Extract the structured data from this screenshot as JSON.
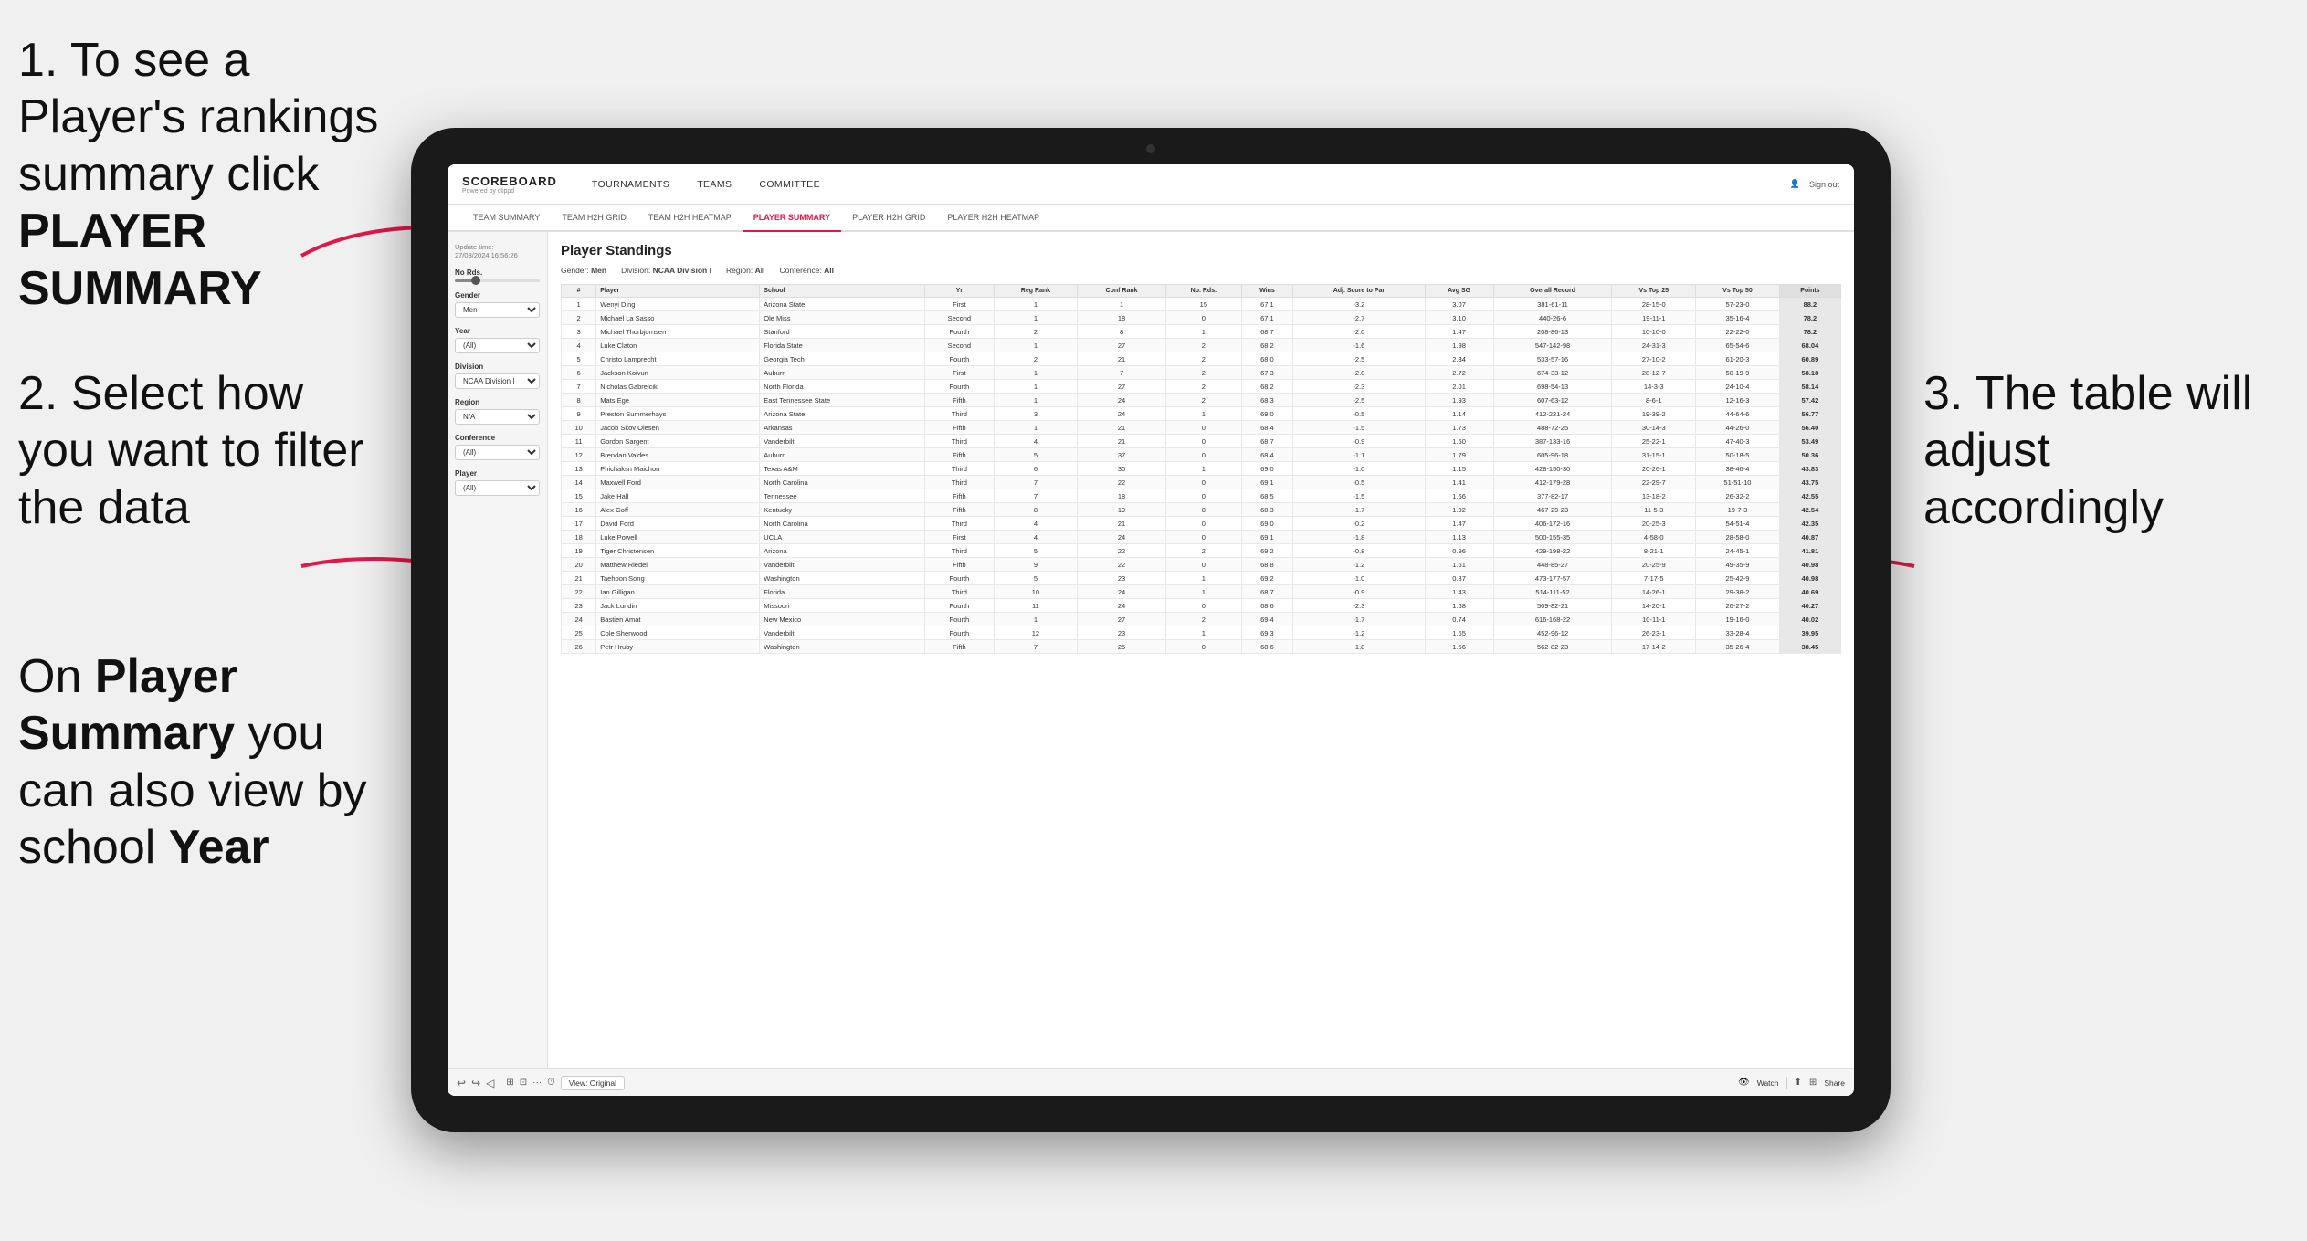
{
  "instructions": {
    "step1": "1. To see a Player's rankings summary click ",
    "step1_bold": "PLAYER SUMMARY",
    "step2": "2. Select how you want to filter the data",
    "step3": "3. The table will adjust accordingly",
    "step4_prefix": "On ",
    "step4_bold1": "Player Summary",
    "step4_middle": " you can also view by school ",
    "step4_bold2": "Year"
  },
  "header": {
    "logo": "SCOREBOARD",
    "logo_sub": "Powered by clippd",
    "nav": [
      "TOURNAMENTS",
      "TEAMS",
      "COMMITTEE"
    ],
    "sign_out": "Sign out"
  },
  "sub_nav": {
    "items": [
      "TEAM SUMMARY",
      "TEAM H2H GRID",
      "TEAM H2H HEATMAP",
      "PLAYER SUMMARY",
      "PLAYER H2H GRID",
      "PLAYER H2H HEATMAP"
    ],
    "active": "PLAYER SUMMARY"
  },
  "sidebar": {
    "update_label": "Update time:",
    "update_time": "27/03/2024 16:56:26",
    "no_rds_label": "No Rds.",
    "gender_label": "Gender",
    "gender_value": "Men",
    "year_label": "Year",
    "year_value": "(All)",
    "division_label": "Division",
    "division_value": "NCAA Division I",
    "region_label": "Region",
    "region_value": "N/A",
    "conference_label": "Conference",
    "conference_value": "(All)",
    "player_label": "Player",
    "player_value": "(All)"
  },
  "table": {
    "title": "Player Standings",
    "filters": {
      "gender_label": "Gender:",
      "gender_value": "Men",
      "division_label": "Division:",
      "division_value": "NCAA Division I",
      "region_label": "Region:",
      "region_value": "All",
      "conference_label": "Conference:",
      "conference_value": "All"
    },
    "columns": [
      "#",
      "Player",
      "School",
      "Yr",
      "Reg Rank",
      "Conf Rank",
      "No. Rds.",
      "Wins",
      "Adj. Score to Par",
      "Avg SG",
      "Overall Record",
      "Vs Top 25",
      "Vs Top 50",
      "Points"
    ],
    "rows": [
      [
        "1",
        "Wenyi Ding",
        "Arizona State",
        "First",
        "1",
        "1",
        "15",
        "67.1",
        "-3.2",
        "3.07",
        "381-61-11",
        "28-15-0",
        "57-23-0",
        "88.2"
      ],
      [
        "2",
        "Michael La Sasso",
        "Ole Miss",
        "Second",
        "1",
        "18",
        "0",
        "67.1",
        "-2.7",
        "3.10",
        "440-26-6",
        "19-11-1",
        "35-16-4",
        "78.2"
      ],
      [
        "3",
        "Michael Thorbjornsen",
        "Stanford",
        "Fourth",
        "2",
        "8",
        "1",
        "68.7",
        "-2.0",
        "1.47",
        "208-86-13",
        "10-10-0",
        "22-22-0",
        "78.2"
      ],
      [
        "4",
        "Luke Claton",
        "Florida State",
        "Second",
        "1",
        "27",
        "2",
        "68.2",
        "-1.6",
        "1.98",
        "547-142-98",
        "24-31-3",
        "65-54-6",
        "68.04"
      ],
      [
        "5",
        "Christo Lamprecht",
        "Georgia Tech",
        "Fourth",
        "2",
        "21",
        "2",
        "68.0",
        "-2.5",
        "2.34",
        "533-57-16",
        "27-10-2",
        "61-20-3",
        "60.89"
      ],
      [
        "6",
        "Jackson Koivun",
        "Auburn",
        "First",
        "1",
        "7",
        "2",
        "67.3",
        "-2.0",
        "2.72",
        "674-33-12",
        "28-12-7",
        "50-19-9",
        "58.18"
      ],
      [
        "7",
        "Nicholas Gabrelcik",
        "North Florida",
        "Fourth",
        "1",
        "27",
        "2",
        "68.2",
        "-2.3",
        "2.01",
        "698-54-13",
        "14-3-3",
        "24-10-4",
        "58.14"
      ],
      [
        "8",
        "Mats Ege",
        "East Tennessee State",
        "Fifth",
        "1",
        "24",
        "2",
        "68.3",
        "-2.5",
        "1.93",
        "607-63-12",
        "8-6-1",
        "12-16-3",
        "57.42"
      ],
      [
        "9",
        "Preston Summerhays",
        "Arizona State",
        "Third",
        "3",
        "24",
        "1",
        "69.0",
        "-0.5",
        "1.14",
        "412-221-24",
        "19-39-2",
        "44-64-6",
        "56.77"
      ],
      [
        "10",
        "Jacob Skov Olesen",
        "Arkansas",
        "Fifth",
        "1",
        "21",
        "0",
        "68.4",
        "-1.5",
        "1.73",
        "488-72-25",
        "30-14-3",
        "44-26-0",
        "56.40"
      ],
      [
        "11",
        "Gordon Sargent",
        "Vanderbilt",
        "Third",
        "4",
        "21",
        "0",
        "68.7",
        "-0.9",
        "1.50",
        "387-133-16",
        "25-22-1",
        "47-40-3",
        "53.49"
      ],
      [
        "12",
        "Brendan Valdes",
        "Auburn",
        "Fifth",
        "5",
        "37",
        "0",
        "68.4",
        "-1.1",
        "1.79",
        "605-96-18",
        "31-15-1",
        "50-18-5",
        "50.36"
      ],
      [
        "13",
        "Phichaksn Maichon",
        "Texas A&M",
        "Third",
        "6",
        "30",
        "1",
        "69.0",
        "-1.0",
        "1.15",
        "428-150-30",
        "20-26-1",
        "38-46-4",
        "43.83"
      ],
      [
        "14",
        "Maxwell Ford",
        "North Carolina",
        "Third",
        "7",
        "22",
        "0",
        "69.1",
        "-0.5",
        "1.41",
        "412-179-28",
        "22-29-7",
        "51-51-10",
        "43.75"
      ],
      [
        "15",
        "Jake Hall",
        "Tennessee",
        "Fifth",
        "7",
        "18",
        "0",
        "68.5",
        "-1.5",
        "1.66",
        "377-82-17",
        "13-18-2",
        "26-32-2",
        "42.55"
      ],
      [
        "16",
        "Alex Goff",
        "Kentucky",
        "Fifth",
        "8",
        "19",
        "0",
        "68.3",
        "-1.7",
        "1.92",
        "467-29-23",
        "11-5-3",
        "19-7-3",
        "42.54"
      ],
      [
        "17",
        "David Ford",
        "North Carolina",
        "Third",
        "4",
        "21",
        "0",
        "69.0",
        "-0.2",
        "1.47",
        "406-172-16",
        "20-25-3",
        "54-51-4",
        "42.35"
      ],
      [
        "18",
        "Luke Powell",
        "UCLA",
        "First",
        "4",
        "24",
        "0",
        "69.1",
        "-1.8",
        "1.13",
        "500-155-35",
        "4-58-0",
        "28-58-0",
        "40.87"
      ],
      [
        "19",
        "Tiger Christensen",
        "Arizona",
        "Third",
        "5",
        "22",
        "2",
        "69.2",
        "-0.8",
        "0.96",
        "429-198-22",
        "8-21-1",
        "24-45-1",
        "41.81"
      ],
      [
        "20",
        "Matthew Riedel",
        "Vanderbilt",
        "Fifth",
        "9",
        "22",
        "0",
        "68.8",
        "-1.2",
        "1.61",
        "448-85-27",
        "20-25-9",
        "49-35-9",
        "40.98"
      ],
      [
        "21",
        "Taehoon Song",
        "Washington",
        "Fourth",
        "5",
        "23",
        "1",
        "69.2",
        "-1.0",
        "0.87",
        "473-177-57",
        "7-17-5",
        "25-42-9",
        "40.98"
      ],
      [
        "22",
        "Ian Gilligan",
        "Florida",
        "Third",
        "10",
        "24",
        "1",
        "68.7",
        "-0.9",
        "1.43",
        "514-111-52",
        "14-26-1",
        "29-38-2",
        "40.69"
      ],
      [
        "23",
        "Jack Lundin",
        "Missouri",
        "Fourth",
        "11",
        "24",
        "0",
        "68.6",
        "-2.3",
        "1.68",
        "509-82-21",
        "14-20-1",
        "26-27-2",
        "40.27"
      ],
      [
        "24",
        "Bastien Amat",
        "New Mexico",
        "Fourth",
        "1",
        "27",
        "2",
        "69.4",
        "-1.7",
        "0.74",
        "616-168-22",
        "10-11-1",
        "19-16-0",
        "40.02"
      ],
      [
        "25",
        "Cole Sherwood",
        "Vanderbilt",
        "Fourth",
        "12",
        "23",
        "1",
        "69.3",
        "-1.2",
        "1.65",
        "452-96-12",
        "26-23-1",
        "33-28-4",
        "39.95"
      ],
      [
        "26",
        "Petr Hruby",
        "Washington",
        "Fifth",
        "7",
        "25",
        "0",
        "68.6",
        "-1.8",
        "1.56",
        "562-82-23",
        "17-14-2",
        "35-26-4",
        "38.45"
      ]
    ]
  },
  "toolbar": {
    "view_label": "View: Original",
    "watch_label": "Watch",
    "share_label": "Share"
  }
}
